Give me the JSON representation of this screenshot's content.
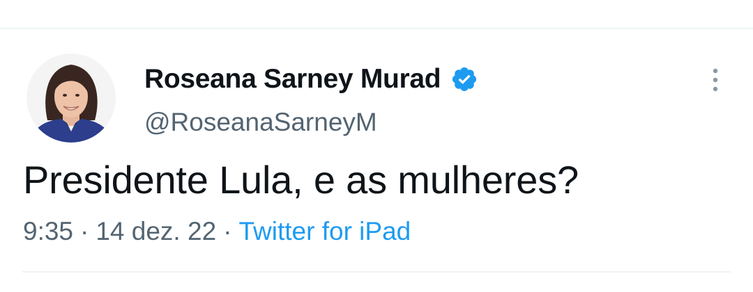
{
  "tweet": {
    "author": {
      "display_name": "Roseana Sarney Murad",
      "handle": "@RoseanaSarneyM",
      "verified_icon": "verified-badge-icon",
      "avatar_icon": "avatar"
    },
    "text": "Presidente Lula, e as mulheres?",
    "meta": {
      "time": "9:35",
      "separator": "·",
      "date": "14 dez. 22",
      "source": "Twitter for iPad"
    },
    "more_icon": "more-options-vertical-icon"
  },
  "colors": {
    "text_primary": "#0f1419",
    "text_secondary": "#536471",
    "link": "#1d9bf0",
    "verified": "#1d9bf0",
    "divider": "#eff3f4",
    "background": "#ffffff"
  }
}
